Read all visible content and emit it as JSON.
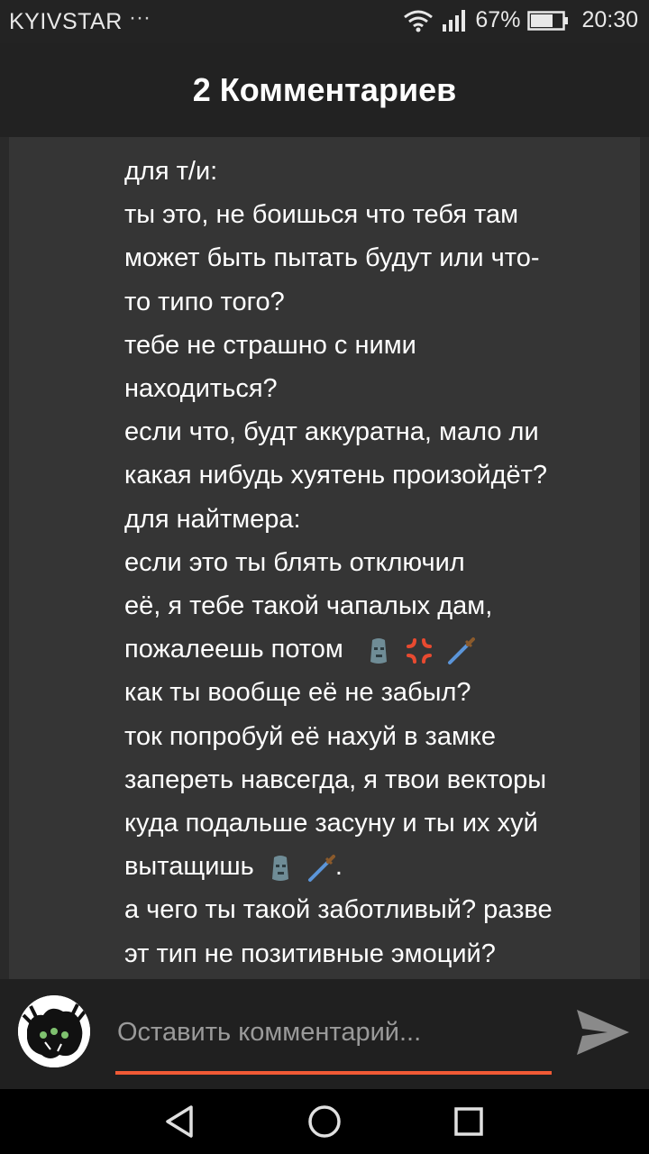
{
  "status_bar": {
    "carrier": "KYIVSTAR",
    "more": "···",
    "battery_percent": "67%",
    "time": "20:30"
  },
  "header": {
    "title": "2 Комментариев"
  },
  "comment": {
    "lines": [
      "для т/и:",
      "ты это, не боишься что тебя там",
      "может быть пытать будут или что-",
      "то типо того?",
      "тебе не страшно с ними",
      "находиться?",
      "если что, будт аккуратна, мало ли",
      "какая нибудь хуятень произойдёт?",
      "для найтмера:",
      "если это ты блять отключил",
      "её, я тебе такой чапалых дам,",
      "пожалеешь потом",
      "как ты вообще её не забыл?",
      "ток попробуй её нахуй в замке",
      "запереть навсегда, я твои векторы",
      "куда подальше засуну и ты их хуй",
      "вытащишь",
      "а чего ты такой заботливый? разве",
      "эт тип не позитивные эмоций?"
    ],
    "line_17_suffix": "."
  },
  "footer": {
    "input_placeholder": "Оставить комментарий..."
  },
  "colors": {
    "accent": "#f05a35",
    "background": "#2a2a2a",
    "panel": "#353535"
  },
  "icons": [
    "wifi-icon",
    "signal-icon",
    "battery-icon",
    "moai-emoji",
    "anger-emoji",
    "dagger-emoji",
    "send-icon",
    "back-icon",
    "home-icon",
    "recents-icon"
  ]
}
